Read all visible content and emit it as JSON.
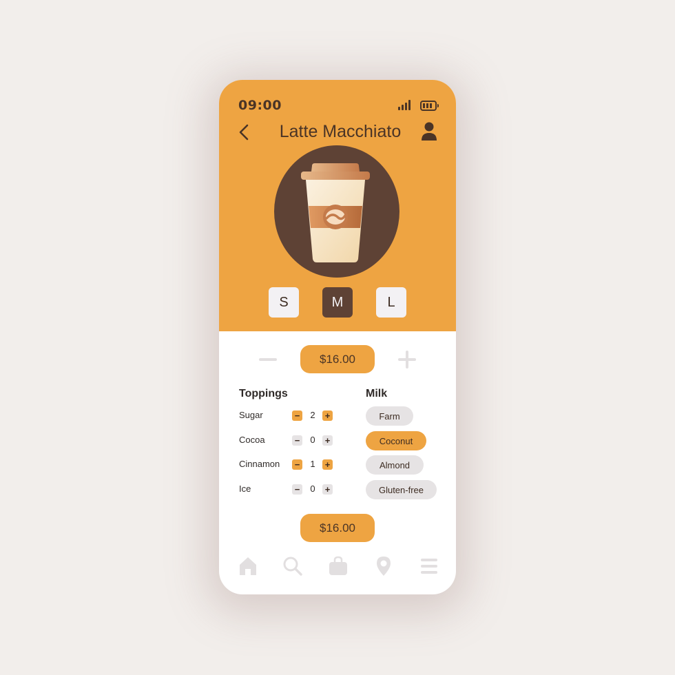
{
  "status_bar": {
    "time": "09:00",
    "signal_icon": "signal-icon",
    "battery_icon": "battery-icon"
  },
  "header": {
    "title": "Latte Macchiato",
    "back_icon": "chevron-left-icon",
    "profile_icon": "user-icon"
  },
  "product": {
    "image": "coffee-cup-icon"
  },
  "sizes": {
    "options": [
      "S",
      "M",
      "L"
    ],
    "selected": "M"
  },
  "quantity": {
    "price": "$16.00",
    "minus_icon": "minus-icon",
    "plus_icon": "plus-icon"
  },
  "toppings": {
    "title": "Toppings",
    "items": [
      {
        "name": "Sugar",
        "count": "2",
        "active": true
      },
      {
        "name": "Cocoa",
        "count": "0",
        "active": false
      },
      {
        "name": "Cinnamon",
        "count": "1",
        "active": true
      },
      {
        "name": "Ice",
        "count": "0",
        "active": false
      }
    ],
    "minus_symbol": "−",
    "plus_symbol": "+"
  },
  "milk": {
    "title": "Milk",
    "options": [
      "Farm",
      "Coconut",
      "Almond",
      "Gluten-free"
    ],
    "selected": "Coconut"
  },
  "total": {
    "price": "$16.00"
  },
  "nav": {
    "items": [
      "home-icon",
      "search-icon",
      "bag-icon",
      "location-pin-icon",
      "menu-icon"
    ]
  },
  "colors": {
    "accent": "#eea442",
    "dark": "#5e4235",
    "text": "#4a3426",
    "chip": "#e6e3e4"
  }
}
